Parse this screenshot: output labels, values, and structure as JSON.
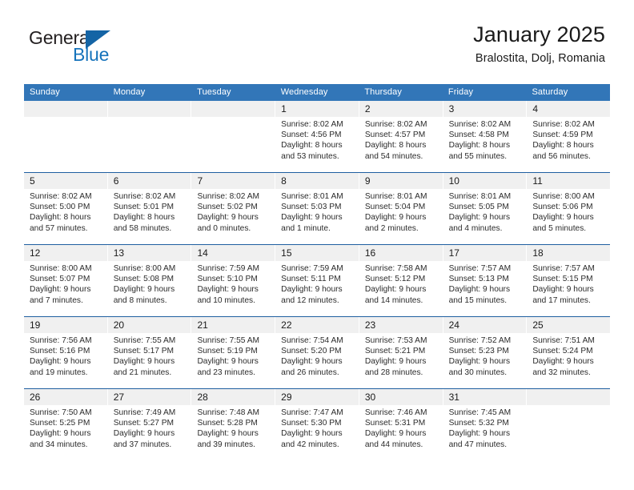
{
  "brand": {
    "word_one": "General",
    "word_two": "Blue",
    "triangle_icon": "triangle-logo-icon",
    "accent_color": "#1464a5",
    "blue_text_color": "#1673bb"
  },
  "header": {
    "title": "January 2025",
    "subtitle": "Bralostita, Dolj, Romania"
  },
  "calendar": {
    "header_bg": "#3276b8",
    "separator_color": "#1f5fa0",
    "day_band_bg": "#f0f0f0",
    "weekday_headers": [
      "Sunday",
      "Monday",
      "Tuesday",
      "Wednesday",
      "Thursday",
      "Friday",
      "Saturday"
    ],
    "weeks": [
      [
        {
          "day": "",
          "sunrise": "",
          "sunset": "",
          "daylight_line1": "",
          "daylight_line2": "",
          "empty": true
        },
        {
          "day": "",
          "sunrise": "",
          "sunset": "",
          "daylight_line1": "",
          "daylight_line2": "",
          "empty": true
        },
        {
          "day": "",
          "sunrise": "",
          "sunset": "",
          "daylight_line1": "",
          "daylight_line2": "",
          "empty": true
        },
        {
          "day": "1",
          "sunrise": "Sunrise: 8:02 AM",
          "sunset": "Sunset: 4:56 PM",
          "daylight_line1": "Daylight: 8 hours",
          "daylight_line2": "and 53 minutes.",
          "empty": false
        },
        {
          "day": "2",
          "sunrise": "Sunrise: 8:02 AM",
          "sunset": "Sunset: 4:57 PM",
          "daylight_line1": "Daylight: 8 hours",
          "daylight_line2": "and 54 minutes.",
          "empty": false
        },
        {
          "day": "3",
          "sunrise": "Sunrise: 8:02 AM",
          "sunset": "Sunset: 4:58 PM",
          "daylight_line1": "Daylight: 8 hours",
          "daylight_line2": "and 55 minutes.",
          "empty": false
        },
        {
          "day": "4",
          "sunrise": "Sunrise: 8:02 AM",
          "sunset": "Sunset: 4:59 PM",
          "daylight_line1": "Daylight: 8 hours",
          "daylight_line2": "and 56 minutes.",
          "empty": false
        }
      ],
      [
        {
          "day": "5",
          "sunrise": "Sunrise: 8:02 AM",
          "sunset": "Sunset: 5:00 PM",
          "daylight_line1": "Daylight: 8 hours",
          "daylight_line2": "and 57 minutes.",
          "empty": false
        },
        {
          "day": "6",
          "sunrise": "Sunrise: 8:02 AM",
          "sunset": "Sunset: 5:01 PM",
          "daylight_line1": "Daylight: 8 hours",
          "daylight_line2": "and 58 minutes.",
          "empty": false
        },
        {
          "day": "7",
          "sunrise": "Sunrise: 8:02 AM",
          "sunset": "Sunset: 5:02 PM",
          "daylight_line1": "Daylight: 9 hours",
          "daylight_line2": "and 0 minutes.",
          "empty": false
        },
        {
          "day": "8",
          "sunrise": "Sunrise: 8:01 AM",
          "sunset": "Sunset: 5:03 PM",
          "daylight_line1": "Daylight: 9 hours",
          "daylight_line2": "and 1 minute.",
          "empty": false
        },
        {
          "day": "9",
          "sunrise": "Sunrise: 8:01 AM",
          "sunset": "Sunset: 5:04 PM",
          "daylight_line1": "Daylight: 9 hours",
          "daylight_line2": "and 2 minutes.",
          "empty": false
        },
        {
          "day": "10",
          "sunrise": "Sunrise: 8:01 AM",
          "sunset": "Sunset: 5:05 PM",
          "daylight_line1": "Daylight: 9 hours",
          "daylight_line2": "and 4 minutes.",
          "empty": false
        },
        {
          "day": "11",
          "sunrise": "Sunrise: 8:00 AM",
          "sunset": "Sunset: 5:06 PM",
          "daylight_line1": "Daylight: 9 hours",
          "daylight_line2": "and 5 minutes.",
          "empty": false
        }
      ],
      [
        {
          "day": "12",
          "sunrise": "Sunrise: 8:00 AM",
          "sunset": "Sunset: 5:07 PM",
          "daylight_line1": "Daylight: 9 hours",
          "daylight_line2": "and 7 minutes.",
          "empty": false
        },
        {
          "day": "13",
          "sunrise": "Sunrise: 8:00 AM",
          "sunset": "Sunset: 5:08 PM",
          "daylight_line1": "Daylight: 9 hours",
          "daylight_line2": "and 8 minutes.",
          "empty": false
        },
        {
          "day": "14",
          "sunrise": "Sunrise: 7:59 AM",
          "sunset": "Sunset: 5:10 PM",
          "daylight_line1": "Daylight: 9 hours",
          "daylight_line2": "and 10 minutes.",
          "empty": false
        },
        {
          "day": "15",
          "sunrise": "Sunrise: 7:59 AM",
          "sunset": "Sunset: 5:11 PM",
          "daylight_line1": "Daylight: 9 hours",
          "daylight_line2": "and 12 minutes.",
          "empty": false
        },
        {
          "day": "16",
          "sunrise": "Sunrise: 7:58 AM",
          "sunset": "Sunset: 5:12 PM",
          "daylight_line1": "Daylight: 9 hours",
          "daylight_line2": "and 14 minutes.",
          "empty": false
        },
        {
          "day": "17",
          "sunrise": "Sunrise: 7:57 AM",
          "sunset": "Sunset: 5:13 PM",
          "daylight_line1": "Daylight: 9 hours",
          "daylight_line2": "and 15 minutes.",
          "empty": false
        },
        {
          "day": "18",
          "sunrise": "Sunrise: 7:57 AM",
          "sunset": "Sunset: 5:15 PM",
          "daylight_line1": "Daylight: 9 hours",
          "daylight_line2": "and 17 minutes.",
          "empty": false
        }
      ],
      [
        {
          "day": "19",
          "sunrise": "Sunrise: 7:56 AM",
          "sunset": "Sunset: 5:16 PM",
          "daylight_line1": "Daylight: 9 hours",
          "daylight_line2": "and 19 minutes.",
          "empty": false
        },
        {
          "day": "20",
          "sunrise": "Sunrise: 7:55 AM",
          "sunset": "Sunset: 5:17 PM",
          "daylight_line1": "Daylight: 9 hours",
          "daylight_line2": "and 21 minutes.",
          "empty": false
        },
        {
          "day": "21",
          "sunrise": "Sunrise: 7:55 AM",
          "sunset": "Sunset: 5:19 PM",
          "daylight_line1": "Daylight: 9 hours",
          "daylight_line2": "and 23 minutes.",
          "empty": false
        },
        {
          "day": "22",
          "sunrise": "Sunrise: 7:54 AM",
          "sunset": "Sunset: 5:20 PM",
          "daylight_line1": "Daylight: 9 hours",
          "daylight_line2": "and 26 minutes.",
          "empty": false
        },
        {
          "day": "23",
          "sunrise": "Sunrise: 7:53 AM",
          "sunset": "Sunset: 5:21 PM",
          "daylight_line1": "Daylight: 9 hours",
          "daylight_line2": "and 28 minutes.",
          "empty": false
        },
        {
          "day": "24",
          "sunrise": "Sunrise: 7:52 AM",
          "sunset": "Sunset: 5:23 PM",
          "daylight_line1": "Daylight: 9 hours",
          "daylight_line2": "and 30 minutes.",
          "empty": false
        },
        {
          "day": "25",
          "sunrise": "Sunrise: 7:51 AM",
          "sunset": "Sunset: 5:24 PM",
          "daylight_line1": "Daylight: 9 hours",
          "daylight_line2": "and 32 minutes.",
          "empty": false
        }
      ],
      [
        {
          "day": "26",
          "sunrise": "Sunrise: 7:50 AM",
          "sunset": "Sunset: 5:25 PM",
          "daylight_line1": "Daylight: 9 hours",
          "daylight_line2": "and 34 minutes.",
          "empty": false
        },
        {
          "day": "27",
          "sunrise": "Sunrise: 7:49 AM",
          "sunset": "Sunset: 5:27 PM",
          "daylight_line1": "Daylight: 9 hours",
          "daylight_line2": "and 37 minutes.",
          "empty": false
        },
        {
          "day": "28",
          "sunrise": "Sunrise: 7:48 AM",
          "sunset": "Sunset: 5:28 PM",
          "daylight_line1": "Daylight: 9 hours",
          "daylight_line2": "and 39 minutes.",
          "empty": false
        },
        {
          "day": "29",
          "sunrise": "Sunrise: 7:47 AM",
          "sunset": "Sunset: 5:30 PM",
          "daylight_line1": "Daylight: 9 hours",
          "daylight_line2": "and 42 minutes.",
          "empty": false
        },
        {
          "day": "30",
          "sunrise": "Sunrise: 7:46 AM",
          "sunset": "Sunset: 5:31 PM",
          "daylight_line1": "Daylight: 9 hours",
          "daylight_line2": "and 44 minutes.",
          "empty": false
        },
        {
          "day": "31",
          "sunrise": "Sunrise: 7:45 AM",
          "sunset": "Sunset: 5:32 PM",
          "daylight_line1": "Daylight: 9 hours",
          "daylight_line2": "and 47 minutes.",
          "empty": false
        },
        {
          "day": "",
          "sunrise": "",
          "sunset": "",
          "daylight_line1": "",
          "daylight_line2": "",
          "empty": true
        }
      ]
    ]
  }
}
